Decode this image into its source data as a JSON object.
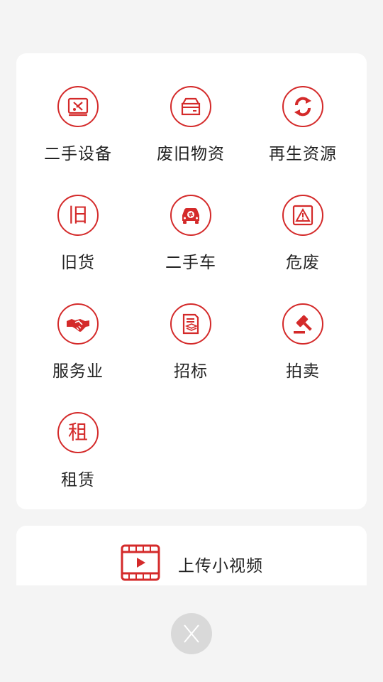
{
  "colors": {
    "accent": "#d42a2a",
    "background": "#f4f4f4",
    "card": "#ffffff",
    "close_bg": "#d9d9d9"
  },
  "categories": [
    {
      "label": "二手设备",
      "icon": "tools-box-icon"
    },
    {
      "label": "废旧物资",
      "icon": "box-icon"
    },
    {
      "label": "再生资源",
      "icon": "recycle-icon"
    },
    {
      "label": "旧货",
      "icon": "jiu-character-icon",
      "glyph": "旧"
    },
    {
      "label": "二手车",
      "icon": "car-icon"
    },
    {
      "label": "危废",
      "icon": "warning-icon"
    },
    {
      "label": "服务业",
      "icon": "handshake-icon"
    },
    {
      "label": "招标",
      "icon": "document-icon"
    },
    {
      "label": "拍卖",
      "icon": "gavel-icon"
    },
    {
      "label": "租赁",
      "icon": "zu-character-icon",
      "glyph": "租"
    }
  ],
  "upload": {
    "label": "上传小视频",
    "icon": "video-icon"
  },
  "close": {
    "icon": "close-icon"
  }
}
